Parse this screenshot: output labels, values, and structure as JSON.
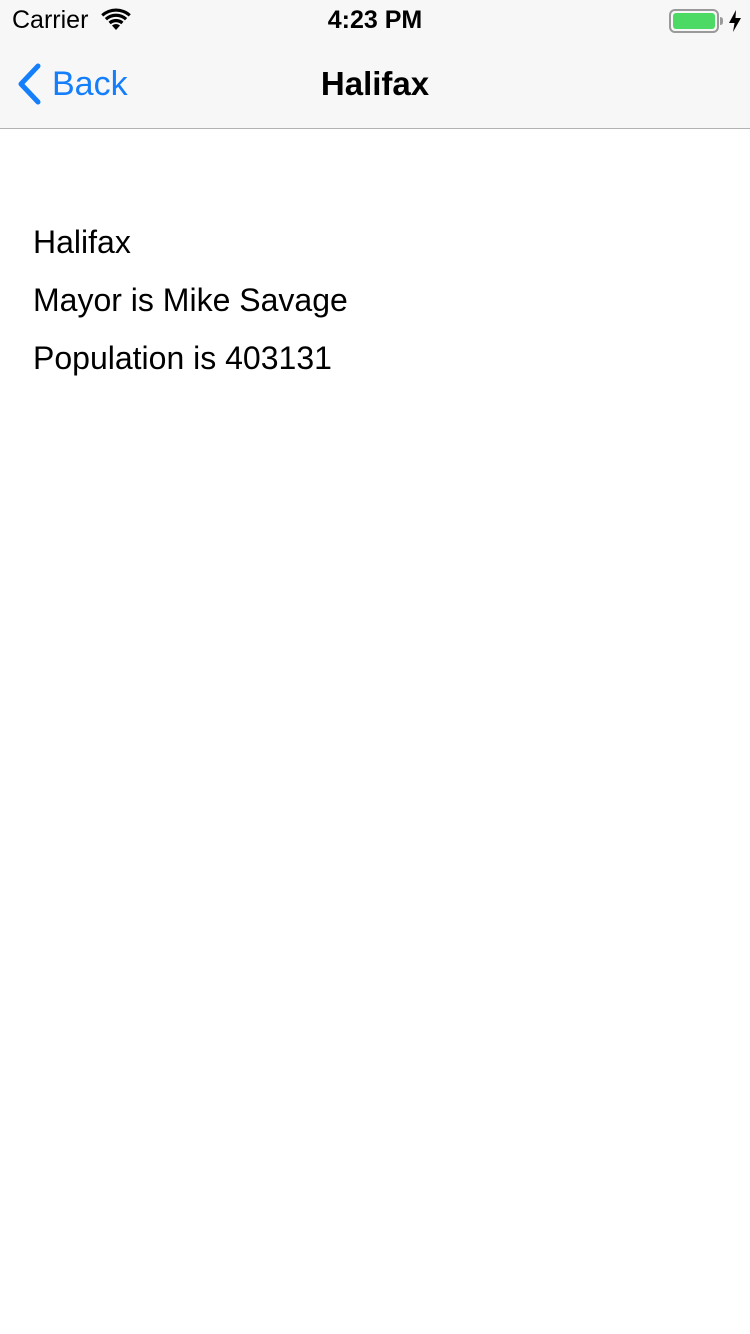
{
  "status_bar": {
    "carrier": "Carrier",
    "time": "4:23 PM",
    "wifi_icon": "wifi-icon",
    "battery_icon": "battery-icon",
    "charging_icon": "charging-bolt-icon",
    "battery_color": "#4cd964"
  },
  "nav": {
    "back_label": "Back",
    "back_icon": "chevron-left-icon",
    "title": "Halifax",
    "accent_color": "#147efb"
  },
  "city": {
    "name": "Halifax",
    "mayor_text": "Mayor is Mike Savage",
    "population_text": "Population is 403131"
  }
}
